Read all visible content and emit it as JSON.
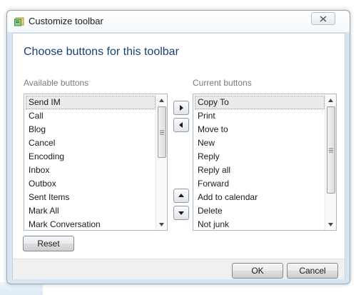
{
  "window": {
    "title": "Customize toolbar"
  },
  "dialog": {
    "heading": "Choose buttons for this toolbar",
    "available_label": "Available buttons",
    "current_label": "Current buttons"
  },
  "available_buttons": [
    "Send IM",
    "Call",
    "Blog",
    "Cancel",
    "Encoding",
    "Inbox",
    "Outbox",
    "Sent Items",
    "Mark All",
    "Mark Conversation"
  ],
  "current_buttons": [
    "Copy To",
    "Print",
    "Move to",
    "New",
    "Reply",
    "Reply all",
    "Forward",
    "Add to calendar",
    "Delete",
    "Not junk"
  ],
  "buttons": {
    "reset": "Reset",
    "ok": "OK",
    "cancel": "Cancel"
  },
  "icons": {
    "close": "close-icon",
    "add": "arrow-right-icon",
    "remove": "arrow-left-icon",
    "move_up": "arrow-up-icon",
    "move_down": "arrow-down-icon"
  },
  "colors": {
    "heading": "#1b3f74",
    "frame": "#d7e4f2",
    "selection": "#ebebeb"
  }
}
